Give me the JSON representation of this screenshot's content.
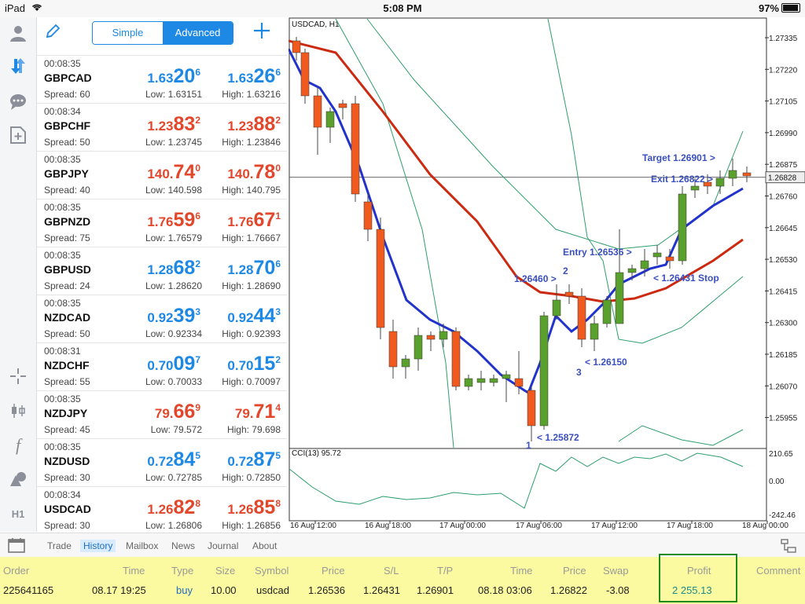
{
  "status": {
    "device": "iPad",
    "time": "5:08 PM",
    "battery": "97%"
  },
  "sidebar": {
    "icons": [
      "account-icon",
      "trade-arrows-icon",
      "chat-icon",
      "new-order-icon",
      "crosshair-icon",
      "candles-icon",
      "indicators-icon",
      "objects-icon",
      "timeframe-icon"
    ],
    "timeframe_label": "H1"
  },
  "quotes": {
    "mode_simple": "Simple",
    "mode_advanced": "Advanced",
    "rows": [
      {
        "time": "00:08:35",
        "symbol": "GBPCAD",
        "spread": "Spread: 60",
        "low": "Low: 1.63151",
        "high": "High: 1.63216",
        "bid_a": "1.63",
        "bid_b": "20",
        "bid_c": "6",
        "ask_a": "1.63",
        "ask_b": "26",
        "ask_c": "6",
        "dir": "up"
      },
      {
        "time": "00:08:34",
        "symbol": "GBPCHF",
        "spread": "Spread: 50",
        "low": "Low: 1.23745",
        "high": "High: 1.23846",
        "bid_a": "1.23",
        "bid_b": "83",
        "bid_c": "2",
        "ask_a": "1.23",
        "ask_b": "88",
        "ask_c": "2",
        "dir": "dn"
      },
      {
        "time": "00:08:35",
        "symbol": "GBPJPY",
        "spread": "Spread: 40",
        "low": "Low: 140.598",
        "high": "High: 140.795",
        "bid_a": "140.",
        "bid_b": "74",
        "bid_c": "0",
        "ask_a": "140.",
        "ask_b": "78",
        "ask_c": "0",
        "dir": "dn"
      },
      {
        "time": "00:08:35",
        "symbol": "GBPNZD",
        "spread": "Spread: 75",
        "low": "Low: 1.76579",
        "high": "High: 1.76667",
        "bid_a": "1.76",
        "bid_b": "59",
        "bid_c": "6",
        "ask_a": "1.76",
        "ask_b": "67",
        "ask_c": "1",
        "dir": "dn"
      },
      {
        "time": "00:08:35",
        "symbol": "GBPUSD",
        "spread": "Spread: 24",
        "low": "Low: 1.28620",
        "high": "High: 1.28690",
        "bid_a": "1.28",
        "bid_b": "68",
        "bid_c": "2",
        "ask_a": "1.28",
        "ask_b": "70",
        "ask_c": "6",
        "dir": "up"
      },
      {
        "time": "00:08:35",
        "symbol": "NZDCAD",
        "spread": "Spread: 50",
        "low": "Low: 0.92334",
        "high": "High: 0.92393",
        "bid_a": "0.92",
        "bid_b": "39",
        "bid_c": "3",
        "ask_a": "0.92",
        "ask_b": "44",
        "ask_c": "3",
        "dir": "up"
      },
      {
        "time": "00:08:31",
        "symbol": "NZDCHF",
        "spread": "Spread: 55",
        "low": "Low: 0.70033",
        "high": "High: 0.70097",
        "bid_a": "0.70",
        "bid_b": "09",
        "bid_c": "7",
        "ask_a": "0.70",
        "ask_b": "15",
        "ask_c": "2",
        "dir": "up"
      },
      {
        "time": "00:08:35",
        "symbol": "NZDJPY",
        "spread": "Spread: 45",
        "low": "Low: 79.572",
        "high": "High: 79.698",
        "bid_a": "79.",
        "bid_b": "66",
        "bid_c": "9",
        "ask_a": "79.",
        "ask_b": "71",
        "ask_c": "4",
        "dir": "dn"
      },
      {
        "time": "00:08:35",
        "symbol": "NZDUSD",
        "spread": "Spread: 30",
        "low": "Low: 0.72785",
        "high": "High: 0.72850",
        "bid_a": "0.72",
        "bid_b": "84",
        "bid_c": "5",
        "ask_a": "0.72",
        "ask_b": "87",
        "ask_c": "5",
        "dir": "up"
      },
      {
        "time": "00:08:34",
        "symbol": "USDCAD",
        "spread": "Spread: 30",
        "low": "Low: 1.26806",
        "high": "High: 1.26856",
        "bid_a": "1.26",
        "bid_b": "82",
        "bid_c": "8",
        "ask_a": "1.26",
        "ask_b": "85",
        "ask_c": "8",
        "dir": "dn"
      }
    ]
  },
  "chart": {
    "symbol_label": "USDCAD, H1",
    "cci_label": "CCI(13) 95.72",
    "price_ticks": [
      "1.27335",
      "1.27220",
      "1.27105",
      "1.26990",
      "1.26875",
      "1.26760",
      "1.26645",
      "1.26530",
      "1.26415",
      "1.26300",
      "1.26185",
      "1.26070",
      "1.25955"
    ],
    "current_price": "1.26828",
    "cci_ticks": [
      "210.65",
      "0.00",
      "-242.46"
    ],
    "time_ticks": [
      "16 Aug 12:00",
      "16 Aug 18:00",
      "17 Aug 00:00",
      "17 Aug 06:00",
      "17 Aug 12:00",
      "17 Aug 18:00",
      "18 Aug 00:00"
    ],
    "annotations": {
      "target": "Target 1.26901 >",
      "exit": "Exit 1.26822 >",
      "entry": "Entry 1.26536 >",
      "stop": "< 1.26431 Stop",
      "p2_price": "1.26460 >",
      "p2": "2",
      "p3_price": "< 1.26150",
      "p3": "3",
      "p1_price": "< 1.25872",
      "p1": "1"
    },
    "colors": {
      "bull": "#5aa02c",
      "bear": "#f05a1e",
      "ema_fast": "#2233cc",
      "ema_slow": "#cc2a10",
      "band": "#2e9e6e",
      "annotation": "#3a4fbf"
    }
  },
  "tabs": {
    "items": [
      "Trade",
      "History",
      "Mailbox",
      "News",
      "Journal",
      "About"
    ],
    "active": "History"
  },
  "history": {
    "headers": [
      "Order",
      "Time",
      "Type",
      "Size",
      "Symbol",
      "Price",
      "S/L",
      "T/P",
      "Time",
      "Price",
      "Swap",
      "Profit",
      "Comment"
    ],
    "row": [
      "225641165",
      "08.17 19:25",
      "buy",
      "10.00",
      "usdcad",
      "1.26536",
      "1.26431",
      "1.26901",
      "08.18 03:06",
      "1.26822",
      "-3.08",
      "2 255.13",
      ""
    ]
  }
}
